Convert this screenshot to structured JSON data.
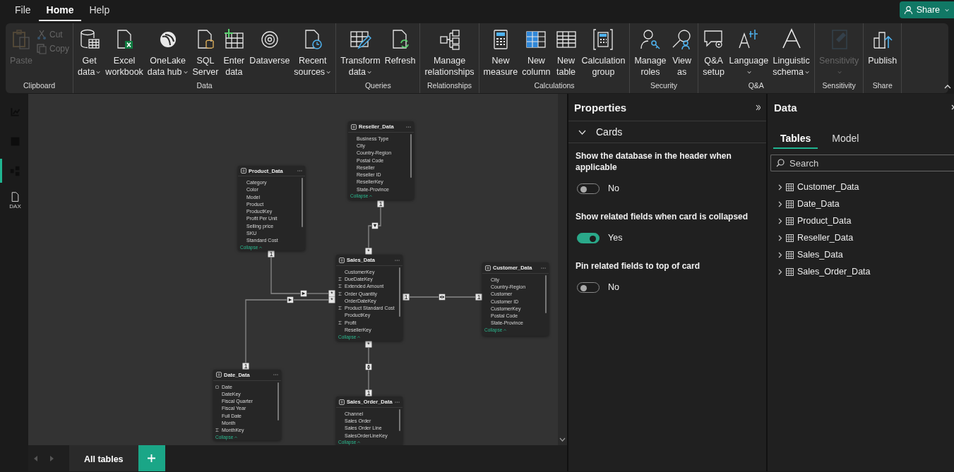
{
  "menu": [
    {
      "label": "File",
      "selected": false
    },
    {
      "label": "Home",
      "selected": true
    },
    {
      "label": "Help",
      "selected": false
    }
  ],
  "share": {
    "label": "Share"
  },
  "ribbon": {
    "groups": [
      {
        "label": "Clipboard",
        "buttons": [
          {
            "kind": "large",
            "lines": [
              "Paste"
            ],
            "dropdown": false,
            "disabled": true
          },
          {
            "kind": "small",
            "lines": [
              "Cut"
            ],
            "disabled": true
          },
          {
            "kind": "small",
            "lines": [
              "Copy"
            ],
            "disabled": true
          }
        ]
      },
      {
        "label": "Data",
        "buttons": [
          {
            "kind": "large",
            "lines": [
              "Get",
              "data"
            ],
            "dropdown": true,
            "disabled": false
          },
          {
            "kind": "large",
            "lines": [
              "Excel",
              "workbook"
            ],
            "dropdown": false,
            "disabled": false
          },
          {
            "kind": "large",
            "lines": [
              "OneLake",
              "data hub"
            ],
            "dropdown": true,
            "disabled": false
          },
          {
            "kind": "large",
            "lines": [
              "SQL",
              "Server"
            ],
            "dropdown": false,
            "disabled": false
          },
          {
            "kind": "large",
            "lines": [
              "Enter",
              "data"
            ],
            "dropdown": false,
            "disabled": false
          },
          {
            "kind": "large",
            "lines": [
              "Dataverse"
            ],
            "dropdown": false,
            "disabled": false
          },
          {
            "kind": "large",
            "lines": [
              "Recent",
              "sources"
            ],
            "dropdown": true,
            "disabled": false
          }
        ]
      },
      {
        "label": "Queries",
        "buttons": [
          {
            "kind": "large",
            "lines": [
              "Transform",
              "data"
            ],
            "dropdown": true,
            "disabled": false
          },
          {
            "kind": "large",
            "lines": [
              "Refresh"
            ],
            "dropdown": false,
            "disabled": false
          }
        ]
      },
      {
        "label": "Relationships",
        "buttons": [
          {
            "kind": "large",
            "lines": [
              "Manage",
              "relationships"
            ],
            "dropdown": false,
            "disabled": false
          }
        ]
      },
      {
        "label": "Calculations",
        "buttons": [
          {
            "kind": "large",
            "lines": [
              "New",
              "measure"
            ],
            "dropdown": false,
            "disabled": false
          },
          {
            "kind": "large",
            "lines": [
              "New",
              "column"
            ],
            "dropdown": false,
            "disabled": false
          },
          {
            "kind": "large",
            "lines": [
              "New",
              "table"
            ],
            "dropdown": false,
            "disabled": false
          },
          {
            "kind": "large",
            "lines": [
              "Calculation",
              "group"
            ],
            "dropdown": false,
            "disabled": false
          }
        ]
      },
      {
        "label": "Security",
        "buttons": [
          {
            "kind": "large",
            "lines": [
              "Manage",
              "roles"
            ],
            "dropdown": false,
            "disabled": false
          },
          {
            "kind": "large",
            "lines": [
              "View",
              "as"
            ],
            "dropdown": false,
            "disabled": false
          }
        ]
      },
      {
        "label": "Q&A",
        "buttons": [
          {
            "kind": "large",
            "lines": [
              "Q&A",
              "setup"
            ],
            "dropdown": false,
            "disabled": false
          },
          {
            "kind": "large",
            "lines": [
              "Language"
            ],
            "dropdown": true,
            "disabled": false
          },
          {
            "kind": "large",
            "lines": [
              "Linguistic",
              "schema"
            ],
            "dropdown": true,
            "disabled": false
          }
        ]
      },
      {
        "label": "Sensitivity",
        "buttons": [
          {
            "kind": "large",
            "lines": [
              "Sensitivity"
            ],
            "dropdown": true,
            "disabled": true
          }
        ]
      },
      {
        "label": "Share",
        "buttons": [
          {
            "kind": "large",
            "lines": [
              "Publish"
            ],
            "dropdown": false,
            "disabled": false
          }
        ]
      }
    ]
  },
  "rail": [
    {
      "kind": "report",
      "selected": false
    },
    {
      "kind": "table",
      "selected": false
    },
    {
      "kind": "model",
      "selected": true
    },
    {
      "kind": "dax",
      "label": "DAX",
      "selected": false
    }
  ],
  "canvas": {
    "tables": [
      {
        "name": "Reseller_Data",
        "fields": [
          {
            "name": "Business Type",
            "kind": "plain"
          },
          {
            "name": "City",
            "kind": "plain"
          },
          {
            "name": "Country-Region",
            "kind": "plain"
          },
          {
            "name": "Postal Code",
            "kind": "plain"
          },
          {
            "name": "Reseller",
            "kind": "plain"
          },
          {
            "name": "Reseller ID",
            "kind": "plain"
          },
          {
            "name": "ResellerKey",
            "kind": "plain"
          },
          {
            "name": "State-Province",
            "kind": "plain"
          }
        ],
        "collapse": "Collapse"
      },
      {
        "name": "Product_Data",
        "fields": [
          {
            "name": "Category",
            "kind": "plain"
          },
          {
            "name": "Color",
            "kind": "plain"
          },
          {
            "name": "Model",
            "kind": "plain"
          },
          {
            "name": "Product",
            "kind": "plain"
          },
          {
            "name": "ProductKey",
            "kind": "plain"
          },
          {
            "name": "Profit Per Unit",
            "kind": "plain"
          },
          {
            "name": "Selling price",
            "kind": "plain"
          },
          {
            "name": "SKU",
            "kind": "plain"
          },
          {
            "name": "Standard Cost",
            "kind": "plain"
          }
        ],
        "collapse": "Collapse"
      },
      {
        "name": "Sales_Data",
        "fields": [
          {
            "name": "CustomerKey",
            "kind": "plain"
          },
          {
            "name": "DueDateKey",
            "kind": "sum"
          },
          {
            "name": "Extended Amount",
            "kind": "sum"
          },
          {
            "name": "Order Quantity",
            "kind": "sum"
          },
          {
            "name": "OrderDateKey",
            "kind": "plain"
          },
          {
            "name": "Product Standard Cost",
            "kind": "sum"
          },
          {
            "name": "ProductKey",
            "kind": "plain"
          },
          {
            "name": "Profit",
            "kind": "sum"
          },
          {
            "name": "ResellerKey",
            "kind": "plain"
          }
        ],
        "collapse": "Collapse"
      },
      {
        "name": "Customer_Data",
        "fields": [
          {
            "name": "City",
            "kind": "plain"
          },
          {
            "name": "Country-Region",
            "kind": "plain"
          },
          {
            "name": "Customer",
            "kind": "plain"
          },
          {
            "name": "Customer ID",
            "kind": "plain"
          },
          {
            "name": "CustomerKey",
            "kind": "plain"
          },
          {
            "name": "Postal Code",
            "kind": "plain"
          },
          {
            "name": "State-Province",
            "kind": "plain"
          }
        ],
        "collapse": "Collapse"
      },
      {
        "name": "Date_Data",
        "fields": [
          {
            "name": "Date",
            "kind": "date"
          },
          {
            "name": "DateKey",
            "kind": "plain"
          },
          {
            "name": "Fiscal Quarter",
            "kind": "plain"
          },
          {
            "name": "Fiscal Year",
            "kind": "plain"
          },
          {
            "name": "Full Date",
            "kind": "plain"
          },
          {
            "name": "Month",
            "kind": "plain"
          },
          {
            "name": "MonthKey",
            "kind": "sum"
          }
        ],
        "collapse": "Collapse"
      },
      {
        "name": "Sales_Order_Data",
        "fields": [
          {
            "name": "Channel",
            "kind": "plain"
          },
          {
            "name": "Sales Order",
            "kind": "plain"
          },
          {
            "name": "Sales Order Line",
            "kind": "plain"
          },
          {
            "name": "SalesOrderLineKey",
            "kind": "plain"
          }
        ],
        "collapse": "Collapse"
      }
    ],
    "relationships": [
      {
        "ends": [
          "1",
          "*"
        ],
        "bidirectional": false
      },
      {
        "ends": [
          "1",
          "*"
        ],
        "bidirectional": false
      },
      {
        "ends": [
          "*",
          "1"
        ],
        "bidirectional": false
      },
      {
        "ends": [
          "1",
          "1"
        ],
        "bidirectional": true
      },
      {
        "ends": [
          "*",
          "1"
        ],
        "bidirectional": true
      }
    ]
  },
  "page_tabs": [
    {
      "label": "All tables",
      "selected": true
    }
  ],
  "properties": {
    "title": "Properties",
    "section": {
      "label": "Cards",
      "expanded": true
    },
    "settings": [
      {
        "label": "Show the database in the header when applicable",
        "on": false,
        "state_text": "No"
      },
      {
        "label": "Show related fields when card is collapsed",
        "on": true,
        "state_text": "Yes"
      },
      {
        "label": "Pin related fields to top of card",
        "on": false,
        "state_text": "No"
      }
    ]
  },
  "data_pane": {
    "title": "Data",
    "tabs": [
      {
        "label": "Tables",
        "selected": true
      },
      {
        "label": "Model",
        "selected": false
      }
    ],
    "search": {
      "placeholder": "Search"
    },
    "tables": [
      {
        "name": "Customer_Data",
        "expanded": false
      },
      {
        "name": "Date_Data",
        "expanded": false
      },
      {
        "name": "Product_Data",
        "expanded": false
      },
      {
        "name": "Reseller_Data",
        "expanded": false
      },
      {
        "name": "Sales_Data",
        "expanded": false
      },
      {
        "name": "Sales_Order_Data",
        "expanded": false
      }
    ]
  }
}
